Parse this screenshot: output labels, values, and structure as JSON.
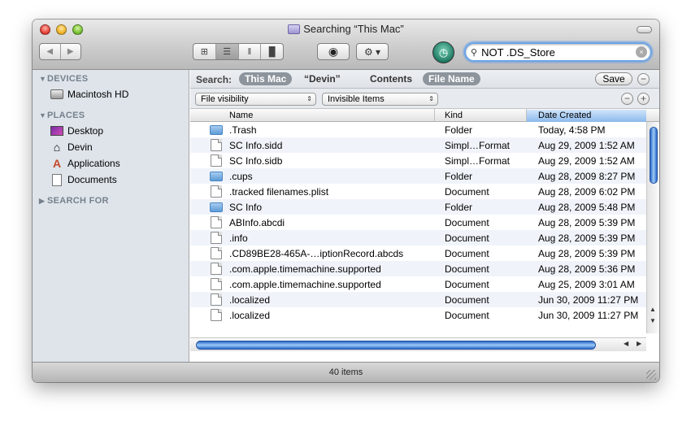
{
  "window": {
    "title": "Searching “This Mac”",
    "nav": {
      "back": "◀",
      "forward": "▶"
    },
    "views": [
      "⊞",
      "☰",
      "‖",
      "█"
    ],
    "eye_glyph": "◉",
    "gear_glyph": "⚙ ▾",
    "tm_glyph": "◷"
  },
  "search": {
    "value": "NOT .DS_Store",
    "mag": "⚲",
    "clear": "×"
  },
  "sidebar": {
    "devices_header": "DEVICES",
    "devices": [
      {
        "label": "Macintosh HD",
        "icon": "hard-drive-icon"
      }
    ],
    "places_header": "PLACES",
    "places": [
      {
        "label": "Desktop",
        "icon": "desktop-icon"
      },
      {
        "label": "Devin",
        "icon": "home-icon"
      },
      {
        "label": "Applications",
        "icon": "applications-icon"
      },
      {
        "label": "Documents",
        "icon": "documents-icon"
      }
    ],
    "search_for_header": "SEARCH FOR",
    "expanded_tri": "▼",
    "collapsed_tri": "▶"
  },
  "searchbar": {
    "search_label": "Search:",
    "scope_this_mac": "This Mac",
    "scope_devin": "“Devin”",
    "contents": "Contents",
    "file_name": "File Name",
    "save": "Save",
    "minus": "−"
  },
  "criteria": {
    "attribute": "File visibility",
    "value": "Invisible Items",
    "remove": "−",
    "add": "+",
    "arrow": "⇕"
  },
  "columns": {
    "name": "Name",
    "kind": "Kind",
    "date": "Date Created"
  },
  "rows": [
    {
      "name": ".Trash",
      "kind": "Folder",
      "date": "Today, 4:58 PM",
      "type": "folder"
    },
    {
      "name": "SC Info.sidd",
      "kind": "Simpl…Format",
      "date": "Aug 29, 2009 1:52 AM",
      "type": "doc"
    },
    {
      "name": "SC Info.sidb",
      "kind": "Simpl…Format",
      "date": "Aug 29, 2009 1:52 AM",
      "type": "doc"
    },
    {
      "name": ".cups",
      "kind": "Folder",
      "date": "Aug 28, 2009 8:27 PM",
      "type": "folder"
    },
    {
      "name": ".tracked filenames.plist",
      "kind": "Document",
      "date": "Aug 28, 2009 6:02 PM",
      "type": "doc"
    },
    {
      "name": "SC Info",
      "kind": "Folder",
      "date": "Aug 28, 2009 5:48 PM",
      "type": "folder"
    },
    {
      "name": "ABInfo.abcdi",
      "kind": "Document",
      "date": "Aug 28, 2009 5:39 PM",
      "type": "doc"
    },
    {
      "name": ".info",
      "kind": "Document",
      "date": "Aug 28, 2009 5:39 PM",
      "type": "doc"
    },
    {
      "name": ".CD89BE28-465A-…iptionRecord.abcds",
      "kind": "Document",
      "date": "Aug 28, 2009 5:39 PM",
      "type": "doc"
    },
    {
      "name": ".com.apple.timemachine.supported",
      "kind": "Document",
      "date": "Aug 28, 2009 5:36 PM",
      "type": "doc"
    },
    {
      "name": ".com.apple.timemachine.supported",
      "kind": "Document",
      "date": "Aug 25, 2009 3:01 AM",
      "type": "doc"
    },
    {
      "name": ".localized",
      "kind": "Document",
      "date": "Jun 30, 2009 11:27 PM",
      "type": "doc"
    },
    {
      "name": ".localized",
      "kind": "Document",
      "date": "Jun 30, 2009 11:27 PM",
      "type": "doc"
    }
  ],
  "scroll_arrows": {
    "up": "▲",
    "down": "▼",
    "left": "◀",
    "right": "▶"
  },
  "status": {
    "count": "40 items"
  }
}
